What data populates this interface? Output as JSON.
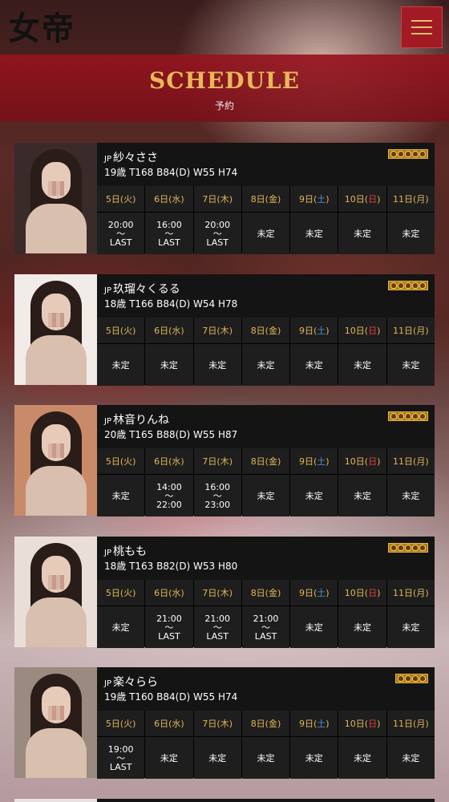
{
  "header": {
    "logo_text": "女帝",
    "menu_icon": "hamburger-icon"
  },
  "banner": {
    "title": "SCHEDULE",
    "subtitle": "予約"
  },
  "colors": {
    "accent_gold": "#e8b858",
    "brand_red": "#a11a24",
    "card_bg": "#141414",
    "saturday_blue": "#4a93e6",
    "sunday_red": "#e53940"
  },
  "week": [
    {
      "num": "5日(",
      "wd": "火",
      "end": ")",
      "type": "weekday"
    },
    {
      "num": "6日(",
      "wd": "水",
      "end": ")",
      "type": "weekday"
    },
    {
      "num": "7日(",
      "wd": "木",
      "end": ")",
      "type": "weekday"
    },
    {
      "num": "8日(",
      "wd": "金",
      "end": ")",
      "type": "weekday"
    },
    {
      "num": "9日(",
      "wd": "土",
      "end": ")",
      "type": "sat"
    },
    {
      "num": "10日(",
      "wd": "日",
      "end": ")",
      "type": "sun"
    },
    {
      "num": "11日(",
      "wd": "月",
      "end": ")",
      "type": "weekday"
    }
  ],
  "cast": [
    {
      "flag": "JP",
      "name": "紗々ささ",
      "stats": "19歳 T168 B84(D) W55 H74",
      "rank_icon": "rank-badge-icon",
      "schedule": [
        [
          "20:00",
          "〜",
          "LAST"
        ],
        [
          "16:00",
          "〜",
          "LAST"
        ],
        [
          "20:00",
          "〜",
          "LAST"
        ],
        [
          "未定"
        ],
        [
          "未定"
        ],
        [
          "未定"
        ],
        [
          "未定"
        ]
      ]
    },
    {
      "flag": "JP",
      "name": "玖瑠々くるる",
      "stats": "18歳 T166 B84(D) W54 H78",
      "rank_icon": "rank-badge-icon",
      "schedule": [
        [
          "未定"
        ],
        [
          "未定"
        ],
        [
          "未定"
        ],
        [
          "未定"
        ],
        [
          "未定"
        ],
        [
          "未定"
        ],
        [
          "未定"
        ]
      ]
    },
    {
      "flag": "JP",
      "name": "林音りんね",
      "stats": "20歳 T165 B88(D) W55 H87",
      "rank_icon": "rank-badge-icon",
      "schedule": [
        [
          "未定"
        ],
        [
          "14:00",
          "〜",
          "22:00"
        ],
        [
          "16:00",
          "〜",
          "23:00"
        ],
        [
          "未定"
        ],
        [
          "未定"
        ],
        [
          "未定"
        ],
        [
          "未定"
        ]
      ]
    },
    {
      "flag": "JP",
      "name": "桃もも",
      "stats": "18歳 T163 B82(D) W53 H80",
      "rank_icon": "rank-badge-icon",
      "schedule": [
        [
          "未定"
        ],
        [
          "21:00",
          "〜",
          "LAST"
        ],
        [
          "21:00",
          "〜",
          "LAST"
        ],
        [
          "21:00",
          "〜",
          "LAST"
        ],
        [
          "未定"
        ],
        [
          "未定"
        ],
        [
          "未定"
        ]
      ]
    },
    {
      "flag": "JP",
      "name": "楽々らら",
      "stats": "19歳 T160 B84(D) W55 H74",
      "rank_icon": "rank-badge-icon",
      "schedule": [
        [
          "19:00",
          "〜",
          "LAST"
        ],
        [
          "未定"
        ],
        [
          "未定"
        ],
        [
          "未定"
        ],
        [
          "未定"
        ],
        [
          "未定"
        ],
        [
          "未定"
        ]
      ]
    }
  ]
}
